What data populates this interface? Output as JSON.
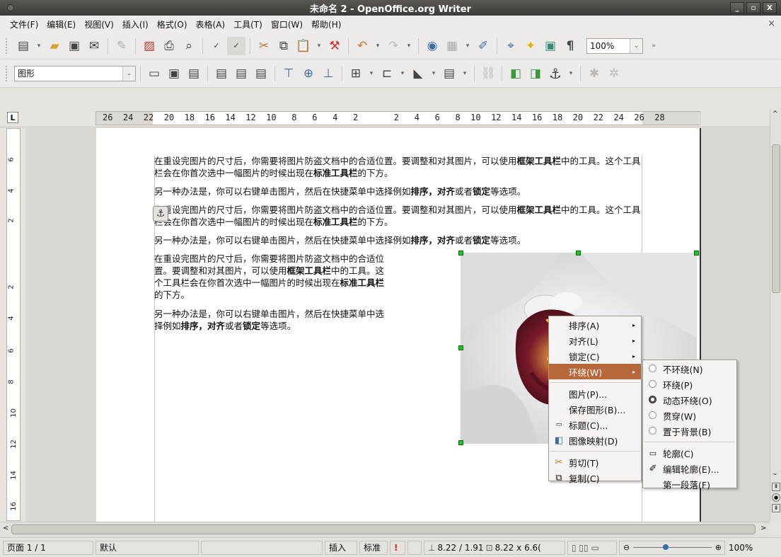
{
  "window": {
    "title": "未命名 2 - OpenOffice.org Writer",
    "buttons": [
      "_",
      "▫",
      "X"
    ]
  },
  "menubar": {
    "items": [
      "文件(F)",
      "编辑(E)",
      "视图(V)",
      "插入(I)",
      "格式(O)",
      "表格(A)",
      "工具(T)",
      "窗口(W)",
      "帮助(H)"
    ],
    "close": "×"
  },
  "toolbar1": {
    "zoom": "100%"
  },
  "toolbar2": {
    "style": "图形"
  },
  "ruler": {
    "corner": "L",
    "numbers": "26  24  22  20  18  16  14  12  10   8   6   4   2       2   4   6   8  10  12  14  16  18  20  22  24  26  28"
  },
  "vruler_labels": [
    "6",
    "4",
    "2",
    "2",
    "4",
    "6",
    "8",
    "10",
    "12",
    "14",
    "16"
  ],
  "document": {
    "p1a": "在重设完图片的尺寸后，你需要将图片防盗文档中的合适位置。要调整和对其图片，可以使用",
    "p1b": "框架工具栏",
    "p1c": "中的工具。这个工具栏会在你首次选中一幅图片的时候出现在",
    "p1d": "标准工具栏",
    "p1e": "的下方。",
    "p2a": "另一种办法是，你可以右键单击图片，然后在快捷菜单中选择例如",
    "p2b": "排序，对齐",
    "p2c": "或者",
    "p2d": "锁定",
    "p2e": "等选项。",
    "anchor": "⚓"
  },
  "context_menu": {
    "items": [
      "排序(A)",
      "对齐(L)",
      "锁定(C)",
      "环绕(W)",
      "图片(P)...",
      "保存图形(B)...",
      "标题(C)...",
      "图像映射(D)",
      "剪切(T)",
      "复制(C)"
    ]
  },
  "wrap_submenu": {
    "items": [
      "不环绕(N)",
      "环绕(P)",
      "动态环绕(O)",
      "贯穿(W)",
      "置于背景(B)",
      "轮廓(C)",
      "编辑轮廓(E)...",
      "第一段落(F)"
    ],
    "selected": "动态环绕(O)"
  },
  "status": {
    "page": "页面 1 / 1",
    "style": "默认",
    "insert": "插入",
    "mode": "标准",
    "position": "8.22 / 1.91",
    "size": "8.22 x 6.6(",
    "zoom": "100%"
  }
}
